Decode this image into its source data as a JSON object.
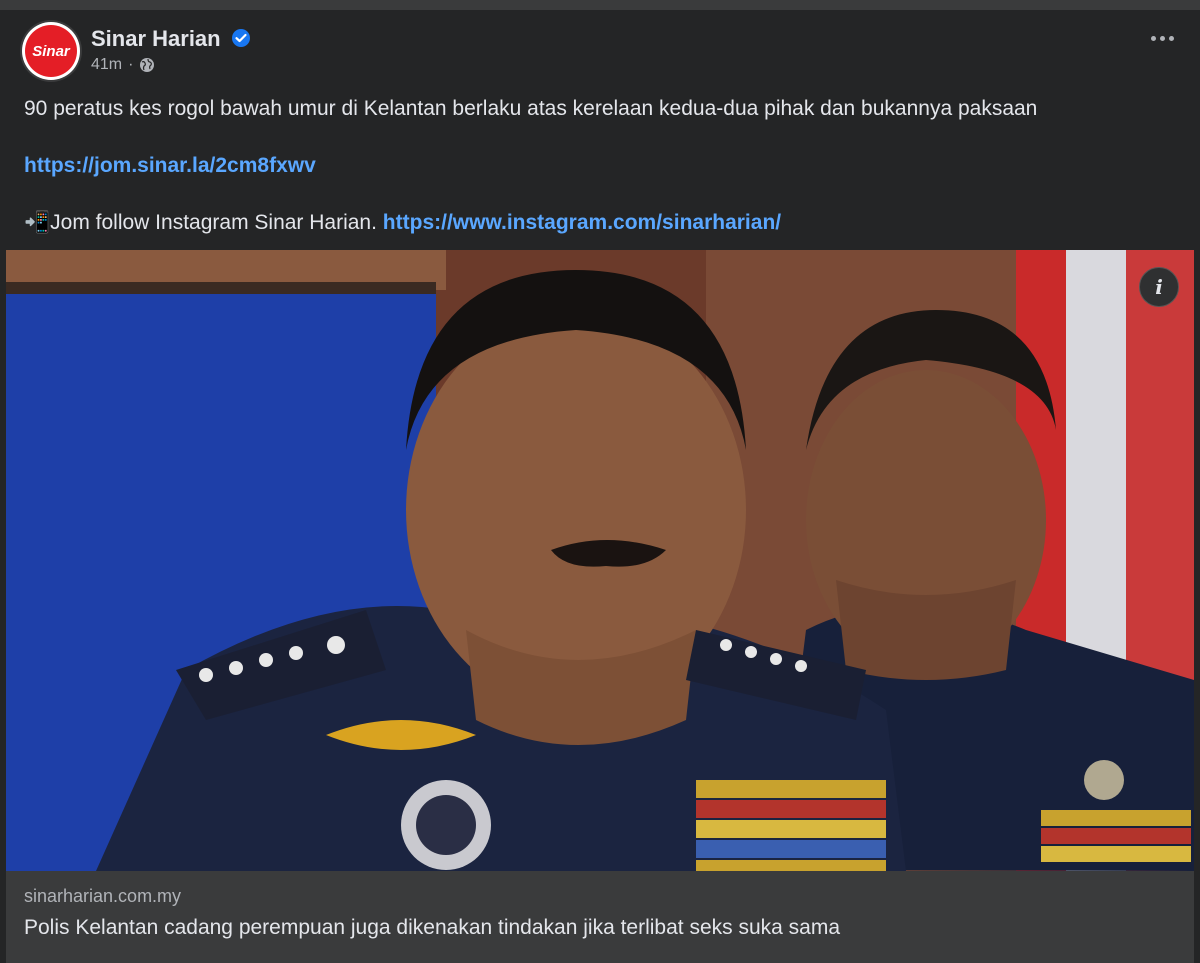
{
  "post": {
    "page_name": "Sinar Harian",
    "avatar_text": "Sinar",
    "time": "41m",
    "separator": "·",
    "caption": "90 peratus kes rogol bawah umur di Kelantan berlaku atas kerelaan kedua-dua pihak dan bukannya paksaan",
    "short_link": "https://jom.sinar.la/2cm8fxwv",
    "follow_emoji": "📲",
    "follow_text": "Jom follow Instagram Sinar Harian. ",
    "instagram_link": "https://www.instagram.com/sinarharian/",
    "info_icon": "i"
  },
  "link_preview": {
    "domain": "sinarharian.com.my",
    "headline": "Polis Kelantan cadang perempuan juga dikenakan tindakan jika terlibat seks suka sama"
  },
  "colors": {
    "background": "#242526",
    "link": "#5aa7ff",
    "brand_red": "#e41e26",
    "verified_blue": "#1877f2"
  }
}
